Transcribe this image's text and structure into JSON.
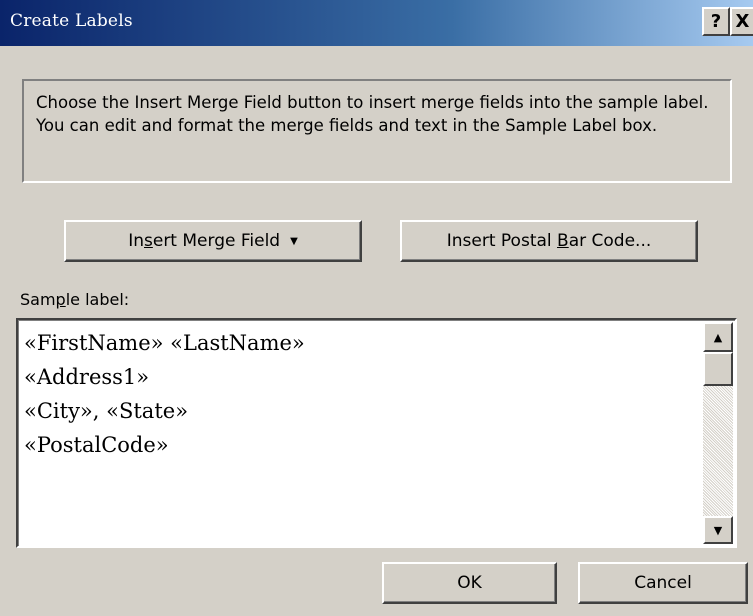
{
  "window": {
    "title": "Create Labels",
    "help_glyph": "?",
    "close_glyph": "X"
  },
  "instructions": {
    "text": "Choose the Insert Merge Field button to insert merge fields into the sample label.  You can edit and format the merge fields and text in the Sample Label box."
  },
  "buttons": {
    "insert_merge_field": {
      "prefix": "In",
      "mnemonic": "s",
      "suffix": "ert Merge Field",
      "arrow": "▼"
    },
    "insert_postal_bar_code": {
      "prefix": "Insert Postal ",
      "mnemonic": "B",
      "suffix": "ar Code..."
    },
    "ok": "OK",
    "cancel": "Cancel"
  },
  "sample_label": {
    "heading": {
      "prefix": "Sam",
      "mnemonic": "p",
      "suffix": "le label:"
    },
    "lines": [
      "«FirstName» «LastName»",
      "«Address1»",
      "«City», «State»",
      "«PostalCode»"
    ]
  },
  "scrollbar": {
    "up_glyph": "▲",
    "down_glyph": "▼"
  },
  "colors": {
    "titlebar_start": "#0a246a",
    "titlebar_end": "#a6caf0",
    "dialog_face": "#d4d0c8"
  }
}
